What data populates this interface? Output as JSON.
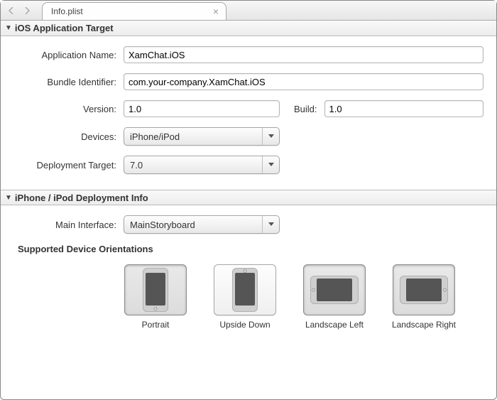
{
  "tab": {
    "title": "Info.plist"
  },
  "sections": {
    "target": "iOS Application Target",
    "deployInfo": "iPhone / iPod Deployment Info"
  },
  "form": {
    "appName": {
      "label": "Application Name:",
      "value": "XamChat.iOS"
    },
    "bundle": {
      "label": "Bundle Identifier:",
      "value": "com.your-company.XamChat.iOS"
    },
    "version": {
      "label": "Version:",
      "value": "1.0"
    },
    "build": {
      "label": "Build:",
      "value": "1.0"
    },
    "devices": {
      "label": "Devices:",
      "value": "iPhone/iPod"
    },
    "deployTarget": {
      "label": "Deployment Target:",
      "value": "7.0"
    },
    "mainInterface": {
      "label": "Main Interface:",
      "value": "MainStoryboard"
    }
  },
  "orientations": {
    "title": "Supported Device Orientations",
    "items": {
      "portrait": {
        "label": "Portrait",
        "selected": true
      },
      "upsideDown": {
        "label": "Upside\nDown",
        "selected": false
      },
      "landscapeLeft": {
        "label": "Landscape\nLeft",
        "selected": true
      },
      "landscapeRight": {
        "label": "Landscape\nRight",
        "selected": true
      }
    }
  }
}
